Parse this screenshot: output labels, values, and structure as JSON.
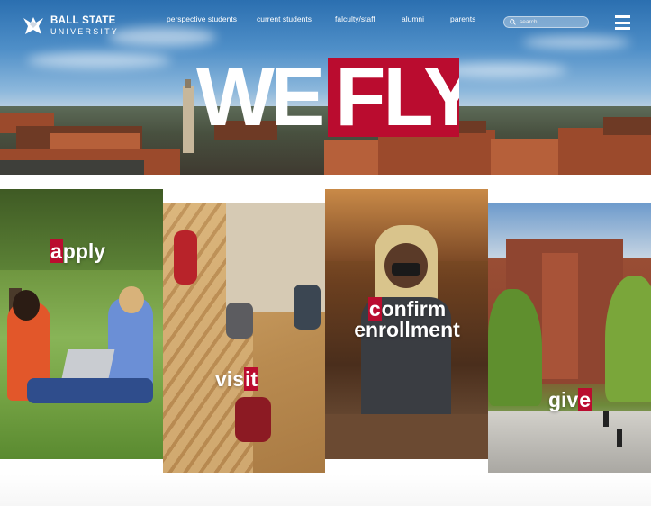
{
  "brand": {
    "line1": "BALL STATE",
    "line2": "UNIVERSITY",
    "logo_icon": "cardinal-logo-icon"
  },
  "nav": {
    "items": [
      {
        "label": "perspective students"
      },
      {
        "label": "current students"
      },
      {
        "label": "falculty/staff"
      },
      {
        "label": "alumni"
      },
      {
        "label": "parents"
      }
    ]
  },
  "search": {
    "placeholder": "search",
    "icon": "search-icon"
  },
  "menu": {
    "icon": "hamburger-menu-icon"
  },
  "hero": {
    "word1": "WE",
    "word2": "FLY"
  },
  "tiles": [
    {
      "parts": [
        "a",
        "pply"
      ],
      "highlight_index": 0
    },
    {
      "parts": [
        "vis",
        "it"
      ],
      "highlight_index": 1
    },
    {
      "parts": [
        "c",
        "onfirm",
        "enrollment"
      ],
      "highlight_index": 0
    },
    {
      "parts": [
        "gi",
        "v",
        "e"
      ],
      "highlight_index": 2
    }
  ],
  "colors": {
    "accent": "#ba0c2f",
    "text_light": "#ffffff"
  }
}
